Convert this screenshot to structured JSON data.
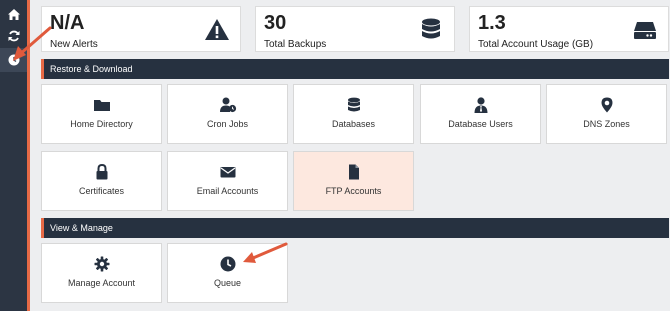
{
  "sidebar": {
    "items": [
      {
        "icon": "home-icon"
      },
      {
        "icon": "refresh-icon"
      },
      {
        "icon": "clock-icon"
      }
    ]
  },
  "stats": [
    {
      "value": "N/A",
      "label": "New Alerts",
      "icon": "warning-icon"
    },
    {
      "value": "30",
      "label": "Total Backups",
      "icon": "database-icon"
    },
    {
      "value": "1.3",
      "label": "Total Account Usage (GB)",
      "icon": "hard-drive-icon"
    }
  ],
  "sections": {
    "restore": {
      "title": "Restore & Download",
      "tiles": [
        {
          "label": "Home Directory",
          "icon": "folder-icon"
        },
        {
          "label": "Cron Jobs",
          "icon": "user-clock-icon"
        },
        {
          "label": "Databases",
          "icon": "database-icon"
        },
        {
          "label": "Database Users",
          "icon": "user-tie-icon"
        },
        {
          "label": "DNS Zones",
          "icon": "map-marker-icon"
        },
        {
          "label": "Certificates",
          "icon": "lock-icon"
        },
        {
          "label": "Email Accounts",
          "icon": "envelope-icon"
        },
        {
          "label": "FTP Accounts",
          "icon": "file-icon"
        }
      ]
    },
    "manage": {
      "title": "View & Manage",
      "tiles": [
        {
          "label": "Manage Account",
          "icon": "gear-icon"
        },
        {
          "label": "Queue",
          "icon": "clock-icon"
        }
      ]
    }
  },
  "colors": {
    "sidebar": "#2c3543",
    "section_bar": "#263140",
    "accent": "#e76a46",
    "highlight_tile": "#fde8df",
    "icon": "#263140"
  }
}
